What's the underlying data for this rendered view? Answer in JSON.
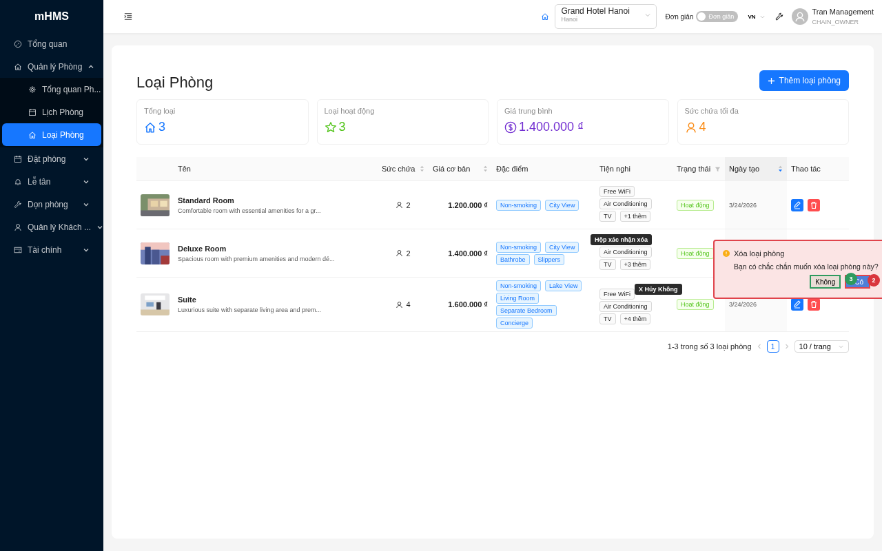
{
  "sidebar": {
    "logo": "mHMS",
    "items": [
      {
        "label": "Tổng quan",
        "expanded": false,
        "selected": false
      },
      {
        "label": "Quản lý Phòng",
        "expanded": true,
        "selected": false,
        "children": [
          {
            "label": "Tổng quan Ph...",
            "selected": false
          },
          {
            "label": "Lịch Phòng",
            "selected": false
          },
          {
            "label": "Loại Phòng",
            "selected": true
          }
        ]
      },
      {
        "label": "Đặt phòng",
        "expanded": false,
        "selected": false
      },
      {
        "label": "Lễ tân",
        "expanded": false,
        "selected": false
      },
      {
        "label": "Dọn phòng",
        "expanded": false,
        "selected": false
      },
      {
        "label": "Quản lý Khách ...",
        "expanded": false,
        "selected": false
      },
      {
        "label": "Tài chính",
        "expanded": false,
        "selected": false
      }
    ]
  },
  "header": {
    "hotel": {
      "name": "Grand Hotel Hanoi",
      "city": "Hanoi"
    },
    "mode_label": "Đơn giản",
    "mode_switch": {
      "label": "Đơn giản",
      "on": false
    },
    "language": "VN",
    "user": {
      "name": "Tran Management",
      "role": "CHAIN_OWNER"
    }
  },
  "page": {
    "title": "Loại Phòng",
    "add_button": "Thêm loại phòng",
    "stats": [
      {
        "label": "Tổng loại",
        "value": "3",
        "color": "#1677ff"
      },
      {
        "label": "Loại hoạt động",
        "value": "3",
        "color": "#52c41a"
      },
      {
        "label": "Giá trung bình",
        "value": "1.400.000 ₫",
        "color": "#722ed1"
      },
      {
        "label": "Sức chứa tối đa",
        "value": "4",
        "color": "#fa8c16"
      }
    ],
    "table": {
      "columns": [
        {
          "label": "Tên",
          "sortable": false,
          "filter": false
        },
        {
          "label": "Sức chứa",
          "sortable": true,
          "sorted": false,
          "filter": false
        },
        {
          "label": "Giá cơ bản",
          "sortable": true,
          "sorted": false,
          "filter": false
        },
        {
          "label": "Đặc điểm",
          "sortable": false,
          "filter": false
        },
        {
          "label": "Tiện nghi",
          "sortable": false,
          "filter": false
        },
        {
          "label": "Trạng thái",
          "sortable": false,
          "filter": true
        },
        {
          "label": "Ngày tạo",
          "sortable": true,
          "sorted": true,
          "filter": false
        },
        {
          "label": "Thao tác",
          "sortable": false,
          "filter": false
        }
      ],
      "rows": [
        {
          "name": "Standard Room",
          "description": "Comfortable room with essential amenities for a gr...",
          "capacity": "2",
          "price": "1.200.000 ₫",
          "features": [
            "Non-smoking",
            "City View"
          ],
          "amenities": [
            "Free WiFi",
            "Air Conditioning",
            "TV",
            "+1 thêm"
          ],
          "status": "Hoạt động",
          "date": "3/24/2026"
        },
        {
          "name": "Deluxe Room",
          "description": "Spacious room with premium amenities and modern dé...",
          "capacity": "2",
          "price": "1.400.000 ₫",
          "features": [
            "Non-smoking",
            "City View",
            "Bathrobe",
            "Slippers"
          ],
          "amenities": [
            "Air Conditioning",
            "TV",
            "+3 thêm"
          ],
          "status": "Hoạt động"
        },
        {
          "name": "Suite",
          "description": "Luxurious suite with separate living area and prem...",
          "capacity": "4",
          "price": "1.600.000 ₫",
          "features": [
            "Non-smoking",
            "Lake View",
            "Living Room",
            "Separate Bedroom",
            "Concierge"
          ],
          "amenities": [
            "Free WiFi",
            "Air Conditioning",
            "TV",
            "+4 thêm"
          ],
          "status": "Hoạt động",
          "date": "3/24/2026"
        }
      ]
    },
    "pagination": {
      "summary": "1-3 trong số 3 loại phòng",
      "pages": [
        {
          "label": "1",
          "selected": true
        }
      ],
      "page_size": "10 / trang"
    }
  },
  "popconfirm": {
    "title": "Xóa loại phòng",
    "message": "Bạn có chắc chắn muốn xóa loại phòng này?",
    "cancel": "Không",
    "ok": "Có"
  },
  "annotations": {
    "labels": [
      "Hộp xác nhận xóa",
      "X Hủy Không"
    ],
    "badges": [
      {
        "label": "3",
        "color": "#2e9a5e"
      },
      {
        "label": "2",
        "color": "#d9363e"
      }
    ]
  }
}
